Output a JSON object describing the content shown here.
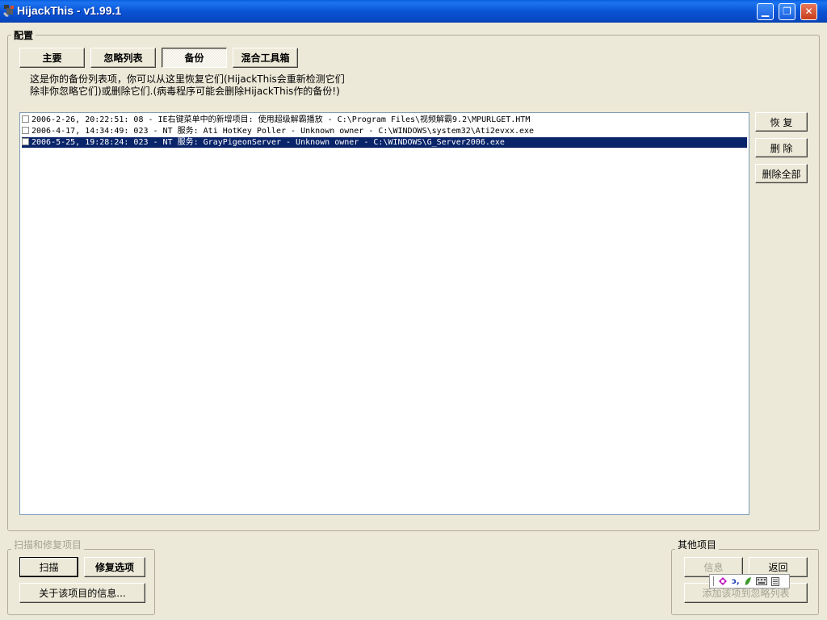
{
  "window": {
    "title": "HijackThis - v1.99.1",
    "minimize_glyph": "▁",
    "restore_glyph": "❐",
    "close_glyph": "✕"
  },
  "config_group": {
    "legend": "配置",
    "tabs": [
      "主要",
      "忽略列表",
      "备份",
      "混合工具箱"
    ],
    "active_tab": "备份",
    "description_line1": "这是你的备份列表项，你可以从这里恢复它们(HijackThis会重新检测它们",
    "description_line2": "除非你忽略它们)或删除它们.(病毒程序可能会删除HijackThis作的备份!)",
    "backup_items": [
      {
        "text": "2006-2-26, 20:22:51: 08 - IE右键菜单中的新增项目: 使用超级解霸播放 - C:\\Program Files\\视频解霸9.2\\MPURLGET.HTM",
        "checked": false,
        "selected": false
      },
      {
        "text": "2006-4-17, 14:34:49: 023 - NT 服务: Ati HotKey Poller - Unknown owner - C:\\WINDOWS\\system32\\Ati2evxx.exe",
        "checked": false,
        "selected": false
      },
      {
        "text": "2006-5-25, 19:28:24: 023 - NT 服务: GrayPigeonServer - Unknown owner - C:\\WINDOWS\\G_Server2006.exe",
        "checked": false,
        "selected": true
      }
    ],
    "restore_label": "恢 复",
    "delete_label": "删 除",
    "delete_all_label": "删除全部"
  },
  "scan_group": {
    "legend": "扫描和修复项目",
    "scan_label": "扫描",
    "fix_label": "修复选项",
    "info_label": "关于该项目的信息..."
  },
  "other_group": {
    "legend": "其他项目",
    "info_label": "信息",
    "back_label": "返回",
    "add_ignore_label": "添加该项到忽略列表"
  },
  "tray": {
    "icons": [
      "ime-icon",
      "lang-icon",
      "leaf-icon",
      "keyboard-icon",
      "menu-icon"
    ],
    "lang_text": "ɔ,"
  },
  "colors": {
    "titlebar": "#0a54d6",
    "face": "#ece9d8",
    "selection": "#0a246a",
    "list_border": "#7f9db9"
  }
}
